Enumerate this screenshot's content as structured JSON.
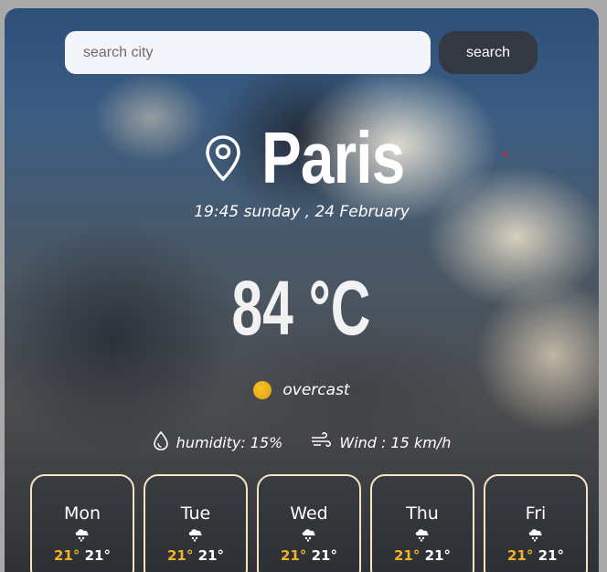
{
  "search": {
    "placeholder": "search city",
    "button_label": "search"
  },
  "city": "Paris",
  "datetime": "19:45 sunday , 24 February",
  "temperature": "84 °C",
  "condition": "overcast",
  "humidity_label": "humidity: 15%",
  "wind_label": "Wind : 15 km/h",
  "forecast": [
    {
      "day": "Mon",
      "high": "21°",
      "low": "21°"
    },
    {
      "day": "Tue",
      "high": "21°",
      "low": "21°"
    },
    {
      "day": "Wed",
      "high": "21°",
      "low": "21°"
    },
    {
      "day": "Thu",
      "high": "21°",
      "low": "21°"
    },
    {
      "day": "Fri",
      "high": "21°",
      "low": "21°"
    }
  ],
  "icons": {
    "location": "map-pin-icon",
    "condition": "sun-icon",
    "humidity": "water-drop-icon",
    "wind": "wind-icon",
    "forecast": "snow-cloud-icon"
  },
  "colors": {
    "accent": "#f0b323",
    "card_border": "#f7e3c4",
    "button": "#333842"
  }
}
